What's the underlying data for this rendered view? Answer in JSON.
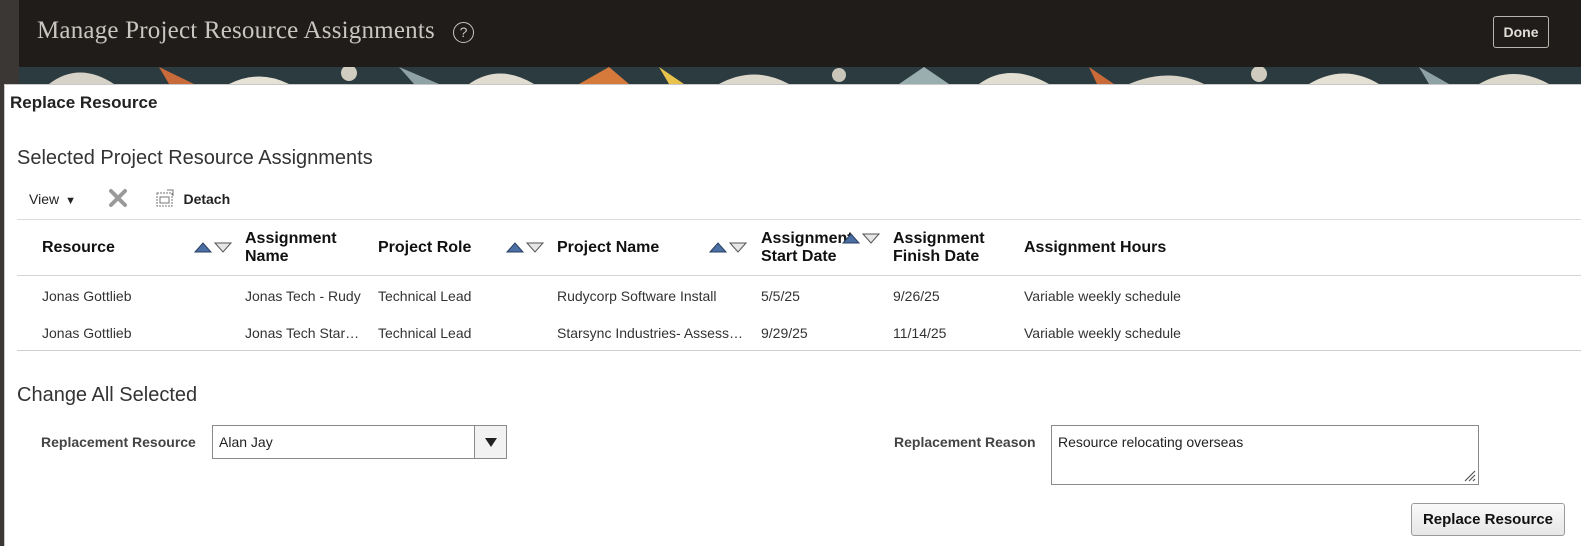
{
  "header": {
    "title": "Manage Project Resource Assignments",
    "help_icon": "question-circle-icon",
    "done_label": "Done"
  },
  "dialog": {
    "title": "Replace Resource",
    "selected_heading": "Selected Project Resource Assignments",
    "toolbar": {
      "view_label": "View",
      "delete_icon": "x-delete-icon",
      "detach_label": "Detach"
    },
    "table": {
      "columns": [
        {
          "label": "Resource",
          "sortable": true
        },
        {
          "label": "Assignment Name",
          "sortable": false
        },
        {
          "label": "Project Role",
          "sortable": true
        },
        {
          "label": "Project Name",
          "sortable": true
        },
        {
          "label": "Assignment Start Date",
          "sortable": true
        },
        {
          "label": "Assignment Finish Date",
          "sortable": false
        },
        {
          "label": "Assignment Hours",
          "sortable": false
        }
      ],
      "col_line1": [
        "Resource",
        "Assignment",
        "Project Role",
        "Project Name",
        "Assignment",
        "Assignment",
        "Assignment Hours"
      ],
      "col_line2": [
        "",
        "Name",
        "",
        "",
        "Start Date",
        "Finish Date",
        ""
      ],
      "rows": [
        [
          "Jonas Gottlieb",
          "Jonas Tech - Rudy",
          "Technical Lead",
          "Rudycorp Software Install",
          "5/5/25",
          "9/26/25",
          "Variable weekly schedule"
        ],
        [
          "Jonas Gottlieb",
          "Jonas Tech Star…",
          "Technical Lead",
          "Starsync Industries- Assess…",
          "9/29/25",
          "11/14/25",
          "Variable weekly schedule"
        ]
      ]
    },
    "change_heading": "Change All Selected",
    "replacement_resource": {
      "label": "Replacement Resource",
      "value": "Alan Jay"
    },
    "replacement_reason": {
      "label": "Replacement Reason",
      "value": "Resource relocating overseas"
    },
    "replace_button_label": "Replace Resource"
  },
  "colors": {
    "header_bg": "#1f1c1a",
    "header_text": "#c9c6c1",
    "sort_up": "#4a6fa5",
    "sort_down": "#777777"
  }
}
